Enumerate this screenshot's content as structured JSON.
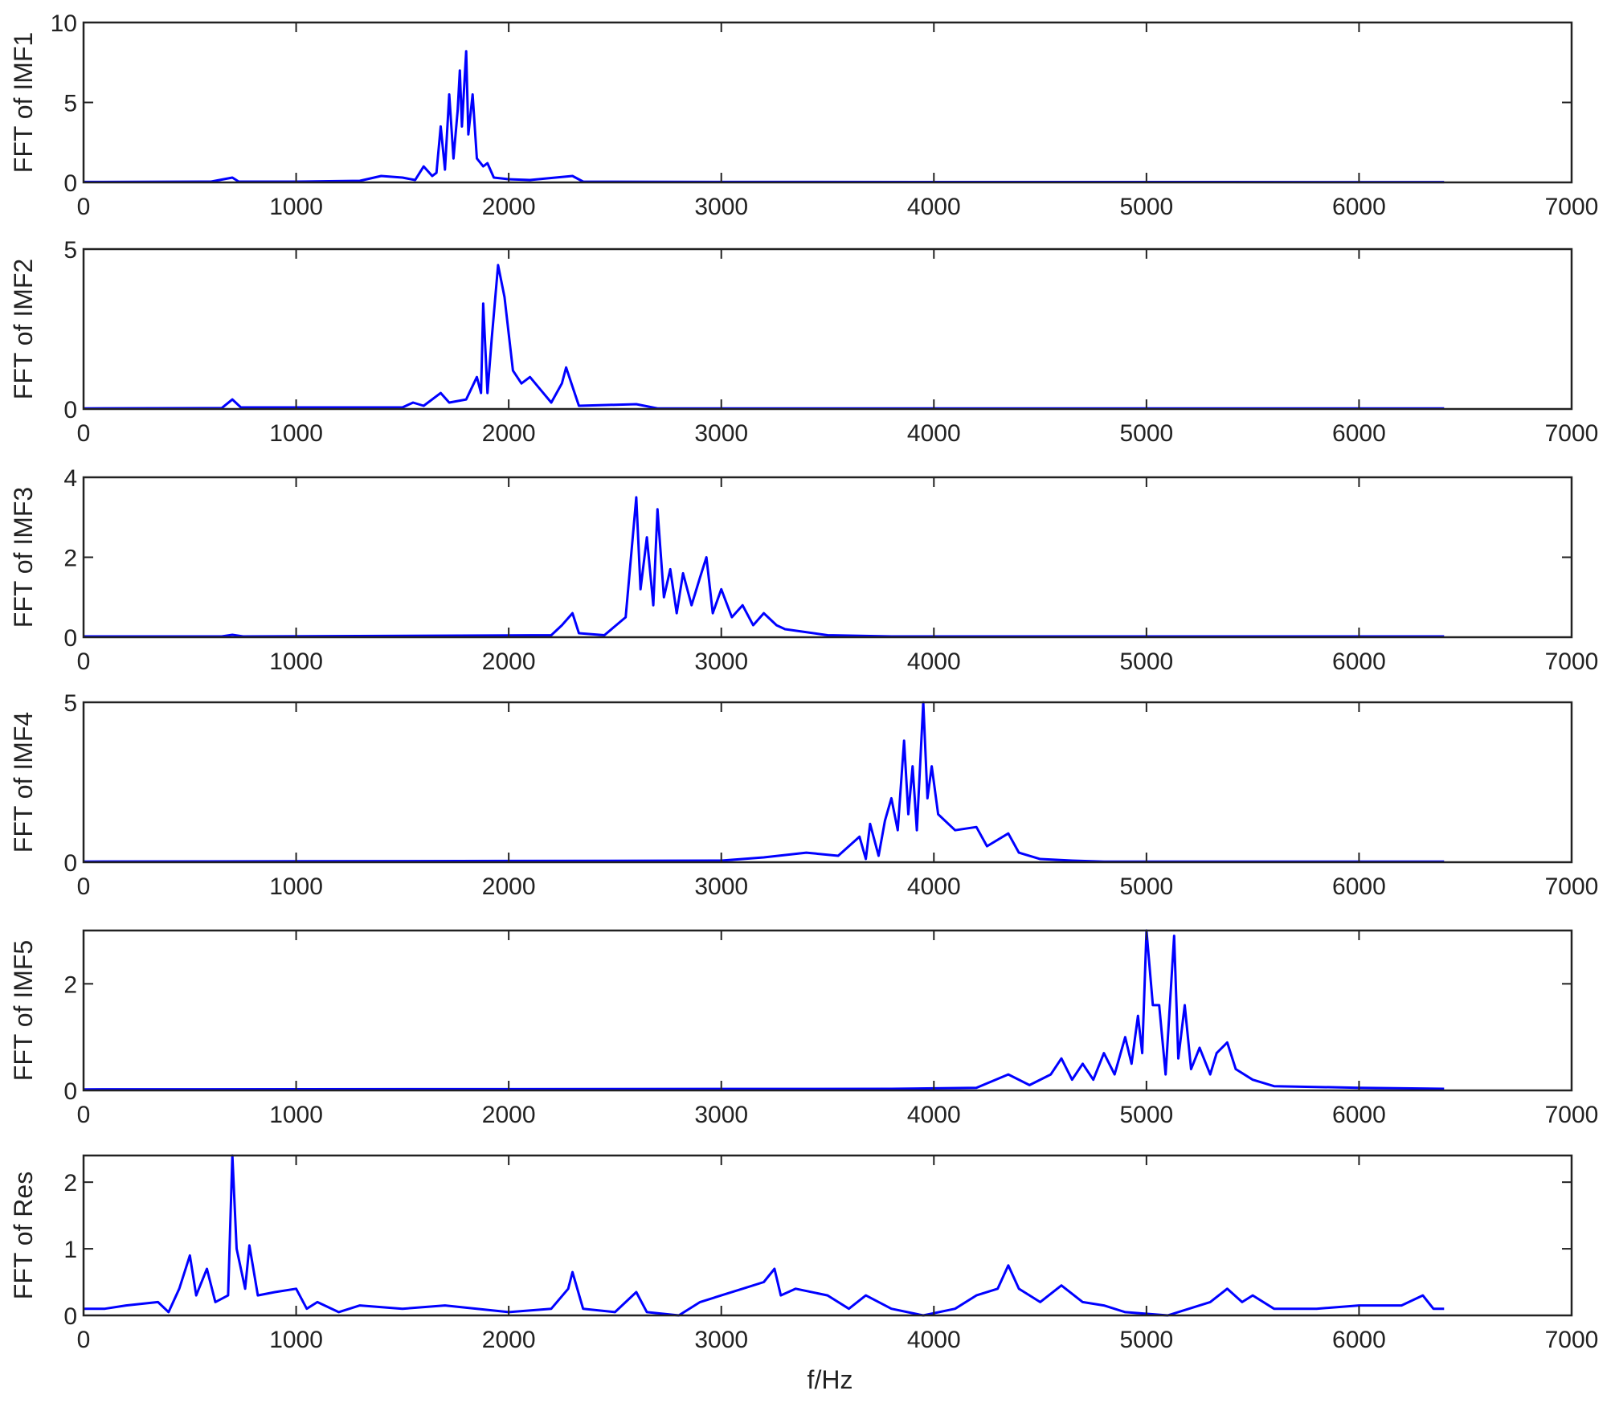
{
  "chart_data": [
    {
      "type": "line",
      "ylabel": "FFT of IMF1",
      "xlim": [
        0,
        7000
      ],
      "ylim": [
        0,
        10
      ],
      "yticks": [
        0,
        5,
        10
      ],
      "xticks": [
        0,
        1000,
        2000,
        3000,
        4000,
        5000,
        6000,
        7000
      ],
      "color": "#0000ff",
      "points": [
        [
          0,
          0.03
        ],
        [
          600,
          0.05
        ],
        [
          700,
          0.3
        ],
        [
          730,
          0.05
        ],
        [
          1000,
          0.05
        ],
        [
          1300,
          0.1
        ],
        [
          1400,
          0.4
        ],
        [
          1500,
          0.3
        ],
        [
          1560,
          0.15
        ],
        [
          1600,
          1.0
        ],
        [
          1640,
          0.4
        ],
        [
          1660,
          0.6
        ],
        [
          1680,
          3.5
        ],
        [
          1700,
          0.8
        ],
        [
          1720,
          5.5
        ],
        [
          1740,
          1.5
        ],
        [
          1760,
          4.5
        ],
        [
          1770,
          7.0
        ],
        [
          1780,
          3.5
        ],
        [
          1800,
          8.2
        ],
        [
          1810,
          3.0
        ],
        [
          1830,
          5.5
        ],
        [
          1850,
          1.5
        ],
        [
          1880,
          1.0
        ],
        [
          1900,
          1.2
        ],
        [
          1930,
          0.3
        ],
        [
          2000,
          0.2
        ],
        [
          2100,
          0.15
        ],
        [
          2300,
          0.4
        ],
        [
          2350,
          0.05
        ],
        [
          3000,
          0.03
        ],
        [
          6400,
          0.02
        ]
      ]
    },
    {
      "type": "line",
      "ylabel": "FFT of IMF2",
      "xlim": [
        0,
        7000
      ],
      "ylim": [
        0,
        5
      ],
      "yticks": [
        0,
        5
      ],
      "xticks": [
        0,
        1000,
        2000,
        3000,
        4000,
        5000,
        6000,
        7000
      ],
      "color": "#0000ff",
      "points": [
        [
          0,
          0.02
        ],
        [
          650,
          0.03
        ],
        [
          700,
          0.3
        ],
        [
          740,
          0.05
        ],
        [
          1500,
          0.05
        ],
        [
          1550,
          0.2
        ],
        [
          1600,
          0.1
        ],
        [
          1680,
          0.5
        ],
        [
          1720,
          0.2
        ],
        [
          1800,
          0.3
        ],
        [
          1850,
          1.0
        ],
        [
          1870,
          0.5
        ],
        [
          1880,
          3.3
        ],
        [
          1900,
          0.5
        ],
        [
          1920,
          2.2
        ],
        [
          1950,
          4.5
        ],
        [
          1980,
          3.5
        ],
        [
          2020,
          1.2
        ],
        [
          2060,
          0.8
        ],
        [
          2100,
          1.0
        ],
        [
          2150,
          0.6
        ],
        [
          2200,
          0.2
        ],
        [
          2250,
          0.8
        ],
        [
          2270,
          1.3
        ],
        [
          2300,
          0.7
        ],
        [
          2330,
          0.1
        ],
        [
          2600,
          0.15
        ],
        [
          2700,
          0.02
        ],
        [
          6400,
          0.02
        ]
      ]
    },
    {
      "type": "line",
      "ylabel": "FFT of IMF3",
      "xlim": [
        0,
        7000
      ],
      "ylim": [
        0,
        4
      ],
      "yticks": [
        0,
        2,
        4
      ],
      "xticks": [
        0,
        1000,
        2000,
        3000,
        4000,
        5000,
        6000,
        7000
      ],
      "color": "#0000ff",
      "points": [
        [
          0,
          0.02
        ],
        [
          650,
          0.02
        ],
        [
          700,
          0.06
        ],
        [
          750,
          0.02
        ],
        [
          2200,
          0.05
        ],
        [
          2250,
          0.3
        ],
        [
          2300,
          0.6
        ],
        [
          2330,
          0.1
        ],
        [
          2450,
          0.05
        ],
        [
          2550,
          0.5
        ],
        [
          2600,
          3.5
        ],
        [
          2620,
          1.2
        ],
        [
          2650,
          2.5
        ],
        [
          2680,
          0.8
        ],
        [
          2700,
          3.2
        ],
        [
          2730,
          1.0
        ],
        [
          2760,
          1.7
        ],
        [
          2790,
          0.6
        ],
        [
          2820,
          1.6
        ],
        [
          2860,
          0.8
        ],
        [
          2900,
          1.5
        ],
        [
          2930,
          2.0
        ],
        [
          2960,
          0.6
        ],
        [
          3000,
          1.2
        ],
        [
          3050,
          0.5
        ],
        [
          3100,
          0.8
        ],
        [
          3150,
          0.3
        ],
        [
          3200,
          0.6
        ],
        [
          3260,
          0.3
        ],
        [
          3300,
          0.2
        ],
        [
          3500,
          0.05
        ],
        [
          3800,
          0.02
        ],
        [
          6400,
          0.02
        ]
      ]
    },
    {
      "type": "line",
      "ylabel": "FFT of IMF4",
      "xlim": [
        0,
        7000
      ],
      "ylim": [
        0,
        5
      ],
      "yticks": [
        0,
        5
      ],
      "xticks": [
        0,
        1000,
        2000,
        3000,
        4000,
        5000,
        6000,
        7000
      ],
      "color": "#0000ff",
      "points": [
        [
          0,
          0.02
        ],
        [
          3000,
          0.05
        ],
        [
          3200,
          0.15
        ],
        [
          3400,
          0.3
        ],
        [
          3550,
          0.2
        ],
        [
          3650,
          0.8
        ],
        [
          3680,
          0.1
        ],
        [
          3700,
          1.2
        ],
        [
          3740,
          0.2
        ],
        [
          3770,
          1.3
        ],
        [
          3800,
          2.0
        ],
        [
          3830,
          1.0
        ],
        [
          3860,
          3.8
        ],
        [
          3880,
          1.5
        ],
        [
          3900,
          3.0
        ],
        [
          3920,
          1.0
        ],
        [
          3950,
          5.0
        ],
        [
          3970,
          2.0
        ],
        [
          3990,
          3.0
        ],
        [
          4020,
          1.5
        ],
        [
          4100,
          1.0
        ],
        [
          4200,
          1.1
        ],
        [
          4250,
          0.5
        ],
        [
          4350,
          0.9
        ],
        [
          4400,
          0.3
        ],
        [
          4500,
          0.1
        ],
        [
          4650,
          0.05
        ],
        [
          4800,
          0.02
        ],
        [
          6400,
          0.02
        ]
      ]
    },
    {
      "type": "line",
      "ylabel": "FFT of IMF5",
      "xlim": [
        0,
        7000
      ],
      "ylim": [
        0,
        3
      ],
      "yticks": [
        0,
        2
      ],
      "xticks": [
        0,
        1000,
        2000,
        3000,
        4000,
        5000,
        6000,
        7000
      ],
      "color": "#0000ff",
      "points": [
        [
          0,
          0.02
        ],
        [
          3800,
          0.03
        ],
        [
          4200,
          0.05
        ],
        [
          4350,
          0.3
        ],
        [
          4450,
          0.1
        ],
        [
          4550,
          0.3
        ],
        [
          4600,
          0.6
        ],
        [
          4650,
          0.2
        ],
        [
          4700,
          0.5
        ],
        [
          4750,
          0.2
        ],
        [
          4800,
          0.7
        ],
        [
          4850,
          0.3
        ],
        [
          4900,
          1.0
        ],
        [
          4930,
          0.5
        ],
        [
          4960,
          1.4
        ],
        [
          4980,
          0.7
        ],
        [
          5000,
          3.1
        ],
        [
          5030,
          1.6
        ],
        [
          5060,
          1.6
        ],
        [
          5090,
          0.3
        ],
        [
          5130,
          2.9
        ],
        [
          5150,
          0.6
        ],
        [
          5180,
          1.6
        ],
        [
          5210,
          0.4
        ],
        [
          5250,
          0.8
        ],
        [
          5300,
          0.3
        ],
        [
          5330,
          0.7
        ],
        [
          5380,
          0.9
        ],
        [
          5420,
          0.4
        ],
        [
          5500,
          0.2
        ],
        [
          5600,
          0.08
        ],
        [
          6000,
          0.05
        ],
        [
          6400,
          0.03
        ]
      ]
    },
    {
      "type": "line",
      "ylabel": "FFT of Res",
      "xlabel": "f/Hz",
      "xlim": [
        0,
        7000
      ],
      "ylim": [
        0,
        2.4
      ],
      "yticks": [
        0,
        1,
        2
      ],
      "xticks": [
        0,
        1000,
        2000,
        3000,
        4000,
        5000,
        6000,
        7000
      ],
      "color": "#0000ff",
      "points": [
        [
          0,
          0.1
        ],
        [
          100,
          0.1
        ],
        [
          200,
          0.15
        ],
        [
          350,
          0.2
        ],
        [
          400,
          0.05
        ],
        [
          450,
          0.4
        ],
        [
          500,
          0.9
        ],
        [
          530,
          0.3
        ],
        [
          580,
          0.7
        ],
        [
          620,
          0.2
        ],
        [
          680,
          0.3
        ],
        [
          700,
          2.4
        ],
        [
          720,
          1.0
        ],
        [
          760,
          0.4
        ],
        [
          780,
          1.05
        ],
        [
          820,
          0.3
        ],
        [
          900,
          0.35
        ],
        [
          1000,
          0.4
        ],
        [
          1050,
          0.1
        ],
        [
          1100,
          0.2
        ],
        [
          1200,
          0.05
        ],
        [
          1300,
          0.15
        ],
        [
          1500,
          0.1
        ],
        [
          1700,
          0.15
        ],
        [
          2000,
          0.05
        ],
        [
          2200,
          0.1
        ],
        [
          2280,
          0.4
        ],
        [
          2300,
          0.65
        ],
        [
          2350,
          0.1
        ],
        [
          2500,
          0.05
        ],
        [
          2600,
          0.35
        ],
        [
          2650,
          0.05
        ],
        [
          2800,
          0.0
        ],
        [
          2900,
          0.2
        ],
        [
          3000,
          0.3
        ],
        [
          3100,
          0.4
        ],
        [
          3200,
          0.5
        ],
        [
          3250,
          0.7
        ],
        [
          3280,
          0.3
        ],
        [
          3350,
          0.4
        ],
        [
          3500,
          0.3
        ],
        [
          3600,
          0.1
        ],
        [
          3680,
          0.3
        ],
        [
          3800,
          0.1
        ],
        [
          3950,
          0.0
        ],
        [
          4100,
          0.1
        ],
        [
          4200,
          0.3
        ],
        [
          4300,
          0.4
        ],
        [
          4350,
          0.75
        ],
        [
          4400,
          0.4
        ],
        [
          4500,
          0.2
        ],
        [
          4600,
          0.45
        ],
        [
          4700,
          0.2
        ],
        [
          4800,
          0.15
        ],
        [
          4900,
          0.05
        ],
        [
          5100,
          0.0
        ],
        [
          5200,
          0.1
        ],
        [
          5300,
          0.2
        ],
        [
          5380,
          0.4
        ],
        [
          5450,
          0.2
        ],
        [
          5500,
          0.3
        ],
        [
          5600,
          0.1
        ],
        [
          5800,
          0.1
        ],
        [
          6000,
          0.15
        ],
        [
          6200,
          0.15
        ],
        [
          6300,
          0.3
        ],
        [
          6350,
          0.1
        ],
        [
          6400,
          0.1
        ]
      ]
    }
  ]
}
